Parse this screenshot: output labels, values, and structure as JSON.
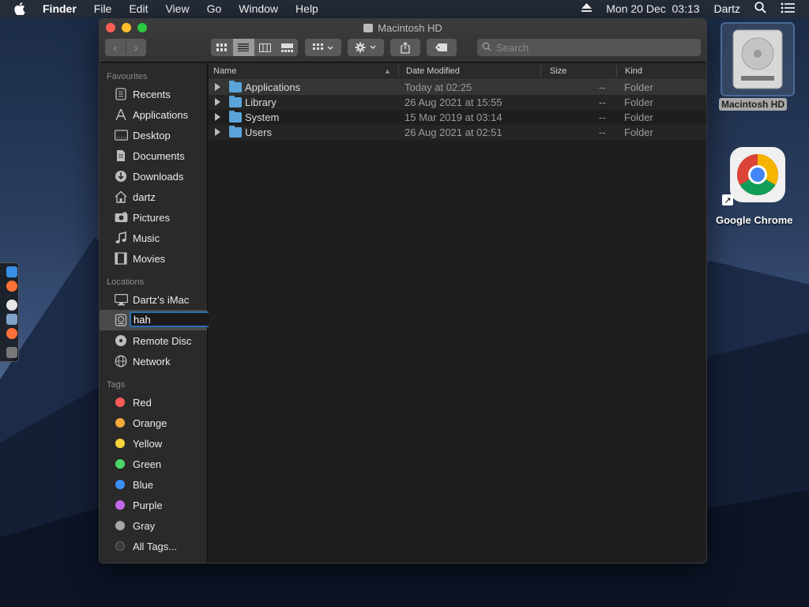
{
  "menubar": {
    "app_name": "Finder",
    "items": [
      "File",
      "Edit",
      "View",
      "Go",
      "Window",
      "Help"
    ],
    "datetime": "Mon 20 Dec  03:13",
    "user": "Dartz"
  },
  "window": {
    "title": "Macintosh HD",
    "search_placeholder": "Search"
  },
  "sidebar": {
    "favourites_heading": "Favourites",
    "favourites": [
      {
        "label": "Recents",
        "icon": "recents-icon"
      },
      {
        "label": "Applications",
        "icon": "applications-icon"
      },
      {
        "label": "Desktop",
        "icon": "desktop-icon"
      },
      {
        "label": "Documents",
        "icon": "documents-icon"
      },
      {
        "label": "Downloads",
        "icon": "downloads-icon"
      },
      {
        "label": "dartz",
        "icon": "home-icon"
      },
      {
        "label": "Pictures",
        "icon": "pictures-icon"
      },
      {
        "label": "Music",
        "icon": "music-icon"
      },
      {
        "label": "Movies",
        "icon": "movies-icon"
      }
    ],
    "locations_heading": "Locations",
    "locations": [
      {
        "label": "Dartz’s iMac",
        "icon": "computer-icon"
      },
      {
        "label": "",
        "icon": "hard-disk-icon",
        "rename_value": "hah"
      },
      {
        "label": "Remote Disc",
        "icon": "remote-disc-icon"
      },
      {
        "label": "Network",
        "icon": "network-icon"
      }
    ],
    "tags_heading": "Tags",
    "tags": [
      {
        "label": "Red",
        "color": "#fe5b57"
      },
      {
        "label": "Orange",
        "color": "#f5a93a"
      },
      {
        "label": "Yellow",
        "color": "#f6d33c"
      },
      {
        "label": "Green",
        "color": "#4dd667"
      },
      {
        "label": "Blue",
        "color": "#3b8ff5"
      },
      {
        "label": "Purple",
        "color": "#c168e6"
      },
      {
        "label": "Gray",
        "color": "#a5a5a5"
      },
      {
        "label": "All Tags...",
        "color": "#3a3a3a"
      }
    ]
  },
  "list": {
    "headers": {
      "name": "Name",
      "date": "Date Modified",
      "size": "Size",
      "kind": "Kind"
    },
    "rows": [
      {
        "name": "Applications",
        "date": "Today at 02:25",
        "size": "--",
        "kind": "Folder"
      },
      {
        "name": "Library",
        "date": "26 Aug 2021 at 15:55",
        "size": "--",
        "kind": "Folder"
      },
      {
        "name": "System",
        "date": "15 Mar 2019 at 03:14",
        "size": "--",
        "kind": "Folder"
      },
      {
        "name": "Users",
        "date": "26 Aug 2021 at 02:51",
        "size": "--",
        "kind": "Folder"
      }
    ]
  },
  "desktop": {
    "hd_label": "Macintosh HD",
    "chrome_label": "Google Chrome"
  },
  "colors": {
    "accent_blue": "#2b6fb0",
    "folder_blue": "#5aa4da"
  }
}
